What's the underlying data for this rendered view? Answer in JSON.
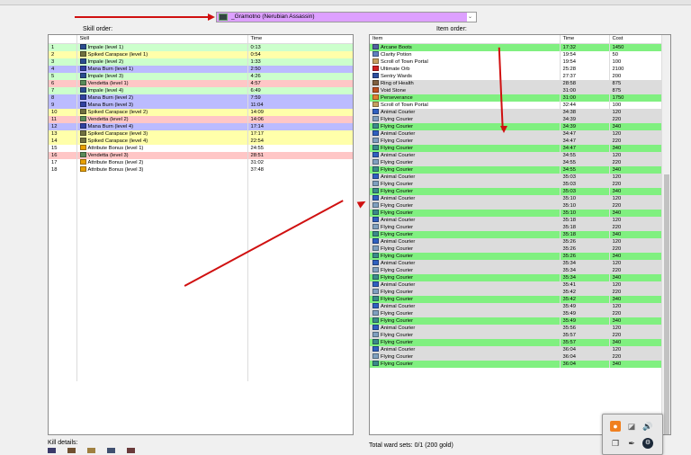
{
  "labels": {
    "skill_order": "Skill order:",
    "item_order": "Item order:",
    "kill_details": "Kill details:",
    "ward_sets": "Total ward sets: 0/1 (200 gold)"
  },
  "hero_select": {
    "value": "_Gramotno (Nerubian Assassin)"
  },
  "skills": {
    "headers": [
      "",
      "Skill",
      "Time"
    ],
    "rows": [
      {
        "n": "1",
        "skill": "Impale (level 1)",
        "time": "0:13",
        "bg": "#ccffcc",
        "icon": "#2a4d8f"
      },
      {
        "n": "2",
        "skill": "Spiked Carapace (level 1)",
        "time": "0:54",
        "bg": "#ffffaa",
        "icon": "#707040"
      },
      {
        "n": "3",
        "skill": "Impale (level 2)",
        "time": "1:33",
        "bg": "#ccffcc",
        "icon": "#2a4d8f"
      },
      {
        "n": "4",
        "skill": "Mana Burn (level 1)",
        "time": "2:50",
        "bg": "#bbbbff",
        "icon": "#3040a0"
      },
      {
        "n": "5",
        "skill": "Impale (level 3)",
        "time": "4:26",
        "bg": "#ccffcc",
        "icon": "#2a4d8f"
      },
      {
        "n": "6",
        "skill": "Vendetta (level 1)",
        "time": "4:57",
        "bg": "#ffc6c6",
        "icon": "#5a8a5a"
      },
      {
        "n": "7",
        "skill": "Impale (level 4)",
        "time": "6:49",
        "bg": "#ccffcc",
        "icon": "#2a4d8f"
      },
      {
        "n": "8",
        "skill": "Mana Burn (level 2)",
        "time": "7:59",
        "bg": "#bbbbff",
        "icon": "#3040a0"
      },
      {
        "n": "9",
        "skill": "Mana Burn (level 3)",
        "time": "11:04",
        "bg": "#bbbbff",
        "icon": "#3040a0"
      },
      {
        "n": "10",
        "skill": "Spiked Carapace (level 2)",
        "time": "14:09",
        "bg": "#ffffaa",
        "icon": "#707040"
      },
      {
        "n": "11",
        "skill": "Vendetta (level 2)",
        "time": "14:06",
        "bg": "#ffc6c6",
        "icon": "#5a8a5a"
      },
      {
        "n": "12",
        "skill": "Mana Burn (level 4)",
        "time": "17:14",
        "bg": "#bbbbff",
        "icon": "#3040a0"
      },
      {
        "n": "13",
        "skill": "Spiked Carapace (level 3)",
        "time": "17:17",
        "bg": "#ffffaa",
        "icon": "#707040"
      },
      {
        "n": "14",
        "skill": "Spiked Carapace (level 4)",
        "time": "22:54",
        "bg": "#ffffaa",
        "icon": "#707040"
      },
      {
        "n": "15",
        "skill": "Attribute Bonus (level 1)",
        "time": "24:55",
        "bg": "#ffffff",
        "icon": "#e8a000"
      },
      {
        "n": "16",
        "skill": "Vendetta (level 3)",
        "time": "28:51",
        "bg": "#ffc6c6",
        "icon": "#5a8a5a"
      },
      {
        "n": "17",
        "skill": "Attribute Bonus (level 2)",
        "time": "31:02",
        "bg": "#ffffff",
        "icon": "#e8a000"
      },
      {
        "n": "18",
        "skill": "Attribute Bonus (level 3)",
        "time": "37:48",
        "bg": "#ffffff",
        "icon": "#e8a000"
      }
    ]
  },
  "items": {
    "headers": [
      "Item",
      "Time",
      "Cost"
    ],
    "rows": [
      {
        "item": "Arcane Boots",
        "time": "17:32",
        "cost": "1450",
        "bg": "#80f080",
        "icon": "#5060a0"
      },
      {
        "item": "Clarity Potion",
        "time": "19:54",
        "cost": "50",
        "bg": "#ffffff",
        "icon": "#6080c0"
      },
      {
        "item": "Scroll of Town Portal",
        "time": "19:54",
        "cost": "100",
        "bg": "#ffffff",
        "icon": "#c8a060"
      },
      {
        "item": "Ultimate Orb",
        "time": "25:28",
        "cost": "2100",
        "bg": "#ffffff",
        "icon": "#d02020"
      },
      {
        "item": "Sentry Wards",
        "time": "27:37",
        "cost": "200",
        "bg": "#ffffff",
        "icon": "#3050a0"
      },
      {
        "item": "Ring of Health",
        "time": "28:58",
        "cost": "875",
        "bg": "#dcdcdc",
        "icon": "#806040"
      },
      {
        "item": "Void Stone",
        "time": "31:00",
        "cost": "875",
        "bg": "#dcdcdc",
        "icon": "#c05020"
      },
      {
        "item": "Perseverance",
        "time": "31:00",
        "cost": "1750",
        "bg": "#80f080",
        "icon": "#e08030"
      },
      {
        "item": "Scroll of Town Portal",
        "time": "32:44",
        "cost": "100",
        "bg": "#ffffff",
        "icon": "#c8a060"
      },
      {
        "item": "Animal Courier",
        "time": "34:38",
        "cost": "120",
        "bg": "#dcdcdc",
        "icon": "#3060c0"
      },
      {
        "item": "Flying Courier",
        "time": "34:39",
        "cost": "220",
        "bg": "#dcdcdc",
        "icon": "#80a0c0"
      },
      {
        "item": "Flying Courier",
        "time": "34:39",
        "cost": "340",
        "bg": "#80f080",
        "icon": "#3a8a8a"
      },
      {
        "item": "Animal Courier",
        "time": "34:47",
        "cost": "120",
        "bg": "#dcdcdc",
        "icon": "#3060c0"
      },
      {
        "item": "Flying Courier",
        "time": "34:47",
        "cost": "220",
        "bg": "#dcdcdc",
        "icon": "#80a0c0"
      },
      {
        "item": "Flying Courier",
        "time": "34:47",
        "cost": "340",
        "bg": "#80f080",
        "icon": "#3a8a8a"
      },
      {
        "item": "Animal Courier",
        "time": "34:55",
        "cost": "120",
        "bg": "#dcdcdc",
        "icon": "#3060c0"
      },
      {
        "item": "Flying Courier",
        "time": "34:55",
        "cost": "220",
        "bg": "#dcdcdc",
        "icon": "#80a0c0"
      },
      {
        "item": "Flying Courier",
        "time": "34:55",
        "cost": "340",
        "bg": "#80f080",
        "icon": "#3a8a8a"
      },
      {
        "item": "Animal Courier",
        "time": "35:03",
        "cost": "120",
        "bg": "#dcdcdc",
        "icon": "#3060c0"
      },
      {
        "item": "Flying Courier",
        "time": "35:03",
        "cost": "220",
        "bg": "#dcdcdc",
        "icon": "#80a0c0"
      },
      {
        "item": "Flying Courier",
        "time": "35:03",
        "cost": "340",
        "bg": "#80f080",
        "icon": "#3a8a8a"
      },
      {
        "item": "Animal Courier",
        "time": "35:10",
        "cost": "120",
        "bg": "#dcdcdc",
        "icon": "#3060c0"
      },
      {
        "item": "Flying Courier",
        "time": "35:10",
        "cost": "220",
        "bg": "#dcdcdc",
        "icon": "#80a0c0"
      },
      {
        "item": "Flying Courier",
        "time": "35:10",
        "cost": "340",
        "bg": "#80f080",
        "icon": "#3a8a8a"
      },
      {
        "item": "Animal Courier",
        "time": "35:18",
        "cost": "120",
        "bg": "#dcdcdc",
        "icon": "#3060c0"
      },
      {
        "item": "Flying Courier",
        "time": "35:18",
        "cost": "220",
        "bg": "#dcdcdc",
        "icon": "#80a0c0"
      },
      {
        "item": "Flying Courier",
        "time": "35:18",
        "cost": "340",
        "bg": "#80f080",
        "icon": "#3a8a8a"
      },
      {
        "item": "Animal Courier",
        "time": "35:26",
        "cost": "120",
        "bg": "#dcdcdc",
        "icon": "#3060c0"
      },
      {
        "item": "Flying Courier",
        "time": "35:26",
        "cost": "220",
        "bg": "#dcdcdc",
        "icon": "#80a0c0"
      },
      {
        "item": "Flying Courier",
        "time": "35:26",
        "cost": "340",
        "bg": "#80f080",
        "icon": "#3a8a8a"
      },
      {
        "item": "Animal Courier",
        "time": "35:34",
        "cost": "120",
        "bg": "#dcdcdc",
        "icon": "#3060c0"
      },
      {
        "item": "Flying Courier",
        "time": "35:34",
        "cost": "220",
        "bg": "#dcdcdc",
        "icon": "#80a0c0"
      },
      {
        "item": "Flying Courier",
        "time": "35:34",
        "cost": "340",
        "bg": "#80f080",
        "icon": "#3a8a8a"
      },
      {
        "item": "Animal Courier",
        "time": "35:41",
        "cost": "120",
        "bg": "#dcdcdc",
        "icon": "#3060c0"
      },
      {
        "item": "Flying Courier",
        "time": "35:42",
        "cost": "220",
        "bg": "#dcdcdc",
        "icon": "#80a0c0"
      },
      {
        "item": "Flying Courier",
        "time": "35:42",
        "cost": "340",
        "bg": "#80f080",
        "icon": "#3a8a8a"
      },
      {
        "item": "Animal Courier",
        "time": "35:49",
        "cost": "120",
        "bg": "#dcdcdc",
        "icon": "#3060c0"
      },
      {
        "item": "Flying Courier",
        "time": "35:49",
        "cost": "220",
        "bg": "#dcdcdc",
        "icon": "#80a0c0"
      },
      {
        "item": "Flying Courier",
        "time": "35:49",
        "cost": "340",
        "bg": "#80f080",
        "icon": "#3a8a8a"
      },
      {
        "item": "Animal Courier",
        "time": "35:56",
        "cost": "120",
        "bg": "#dcdcdc",
        "icon": "#3060c0"
      },
      {
        "item": "Flying Courier",
        "time": "35:57",
        "cost": "220",
        "bg": "#dcdcdc",
        "icon": "#80a0c0"
      },
      {
        "item": "Flying Courier",
        "time": "35:57",
        "cost": "340",
        "bg": "#80f080",
        "icon": "#3a8a8a"
      },
      {
        "item": "Animal Courier",
        "time": "36:04",
        "cost": "120",
        "bg": "#dcdcdc",
        "icon": "#3060c0"
      },
      {
        "item": "Flying Courier",
        "time": "36:04",
        "cost": "220",
        "bg": "#dcdcdc",
        "icon": "#80a0c0"
      },
      {
        "item": "Flying Courier",
        "time": "36:04",
        "cost": "340",
        "bg": "#80f080",
        "icon": "#3a8a8a"
      }
    ]
  },
  "kill_icons": [
    "#3a3a6a",
    "#705030",
    "#a08040",
    "#405070",
    "#6a3a3a"
  ],
  "tray_icons": [
    "orange-flame-icon",
    "headset-icon",
    "speaker-icon",
    "window-icon",
    "pen-icon",
    "steam-icon"
  ]
}
